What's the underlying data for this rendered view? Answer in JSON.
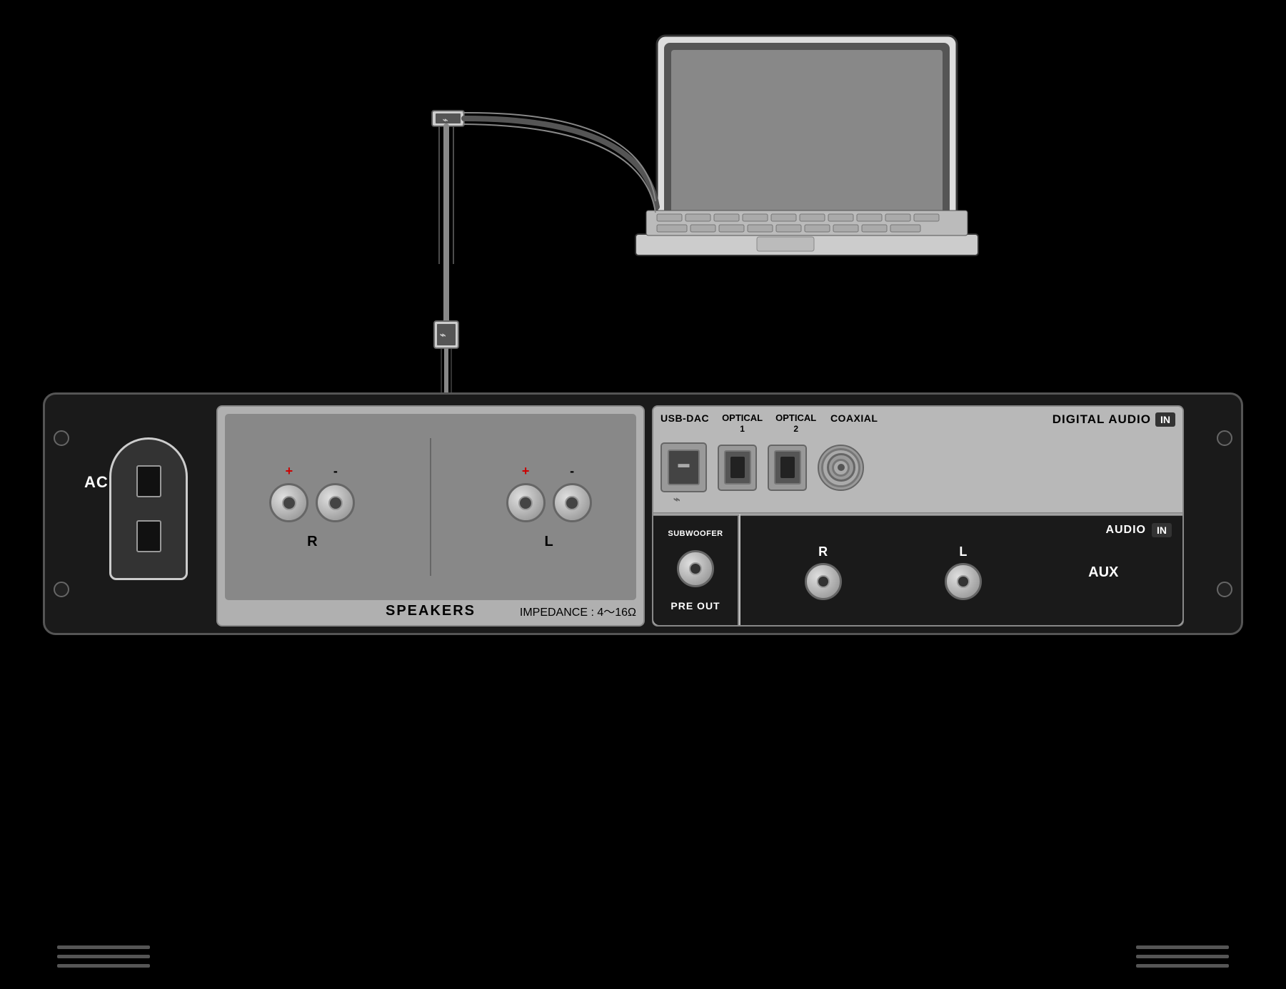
{
  "labels": {
    "ac_in": "AC\nIN",
    "speakers": "SPEAKERS",
    "impedance": "IMPEDANCE : 4～16Ω",
    "digital_audio": "DIGITAL AUDIO",
    "in_badge": "IN",
    "usb_dac": "USB-DAC",
    "optical1": "OPTICAL\n1",
    "optical2": "OPTICAL\n2",
    "coaxial": "COAXIAL",
    "pre_out": "PRE OUT",
    "subwoofer": "SUBWOOFER",
    "audio": "AUDIO",
    "aux": "AUX",
    "r_label": "R",
    "l_label": "L",
    "r_speaker": "R",
    "l_speaker": "L",
    "plus": "+",
    "minus": "-",
    "usb_symbol": "⌁"
  },
  "colors": {
    "background": "#000000",
    "amp_body": "#1a1a1a",
    "panel_gray": "#b0b0b0",
    "dark_panel": "#1a1a1a",
    "text_white": "#ffffff",
    "text_black": "#000000",
    "accent": "#555555"
  }
}
